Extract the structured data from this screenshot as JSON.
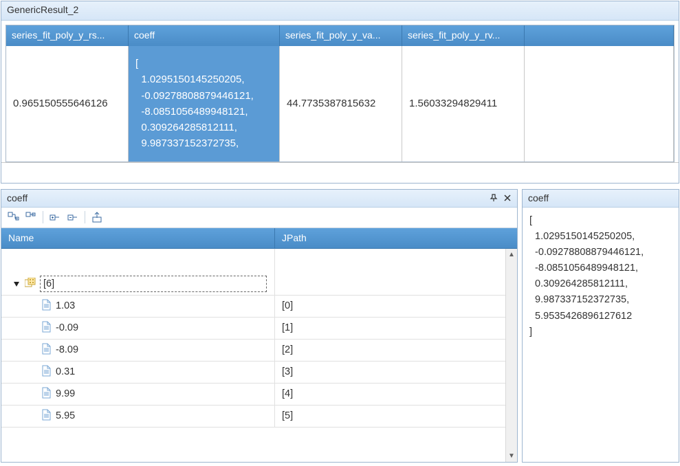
{
  "topPanel": {
    "title": "GenericResult_2",
    "columns": {
      "a": "series_fit_poly_y_rs...",
      "b": "coeff",
      "c": "series_fit_poly_y_va...",
      "d": "series_fit_poly_y_rv..."
    },
    "row": {
      "a": "0.965150555646126",
      "b_lines": [
        "[",
        "  1.0295150145250205,",
        "  -0.09278808879446121,",
        "  -8.0851056489948121,",
        "  0.309264285812111,",
        "  9.987337152372735,"
      ],
      "c": "44.7735387815632",
      "d": "1.56033294829411"
    }
  },
  "treePanel": {
    "title": "coeff",
    "headers": {
      "name": "Name",
      "jpath": "JPath"
    },
    "rootLabel": "[6]",
    "items": [
      {
        "value": "1.03",
        "jpath": "[0]"
      },
      {
        "value": "-0.09",
        "jpath": "[1]"
      },
      {
        "value": "-8.09",
        "jpath": "[2]"
      },
      {
        "value": "0.31",
        "jpath": "[3]"
      },
      {
        "value": "9.99",
        "jpath": "[4]"
      },
      {
        "value": "5.95",
        "jpath": "[5]"
      }
    ]
  },
  "textPanel": {
    "title": "coeff",
    "lines": [
      "[",
      "  1.0295150145250205,",
      "  -0.09278808879446121,",
      "  -8.0851056489948121,",
      "  0.309264285812111,",
      "  9.987337152372735,",
      "  5.9535426896127612",
      "]"
    ]
  }
}
